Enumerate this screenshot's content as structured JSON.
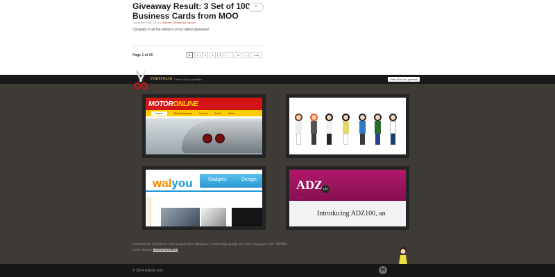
{
  "post": {
    "title": "Giveaway Result: 3 Set of 100 Business Cards from MOO",
    "comment_count": "+",
    "meta_date": "December 15th, 2011 in",
    "meta_categories": "Articles, Review by kailoon",
    "excerpt": "Congrats to all the winners of our latest giveaway!"
  },
  "pagination": {
    "label": "Page 1 of 15",
    "pages": [
      "1",
      "2",
      "3",
      "4",
      "5",
      "...",
      "15",
      "»",
      "Last"
    ]
  },
  "portfolio": {
    "title": "PORTFOLIO",
    "subtitle": "Check out my portfolio",
    "view_all": "View all of my portfolio",
    "tiles": [
      {
        "id": "motoronline",
        "logo_a": "MOTOR",
        "logo_b": "ONLINE",
        "nav": [
          "Home",
          "Berita/Updates",
          "Kereta",
          "Berita",
          "Moto"
        ]
      },
      {
        "id": "characters"
      },
      {
        "id": "walyou",
        "logo_a": "wal",
        "logo_b": "you",
        "nav": [
          "Gadgets",
          "Design"
        ]
      },
      {
        "id": "adz100",
        "logo": "ADZ",
        "badge": "100",
        "tagline": "... ... ...",
        "headline": "Introducing ADZ100, an"
      }
    ]
  },
  "about": {
    "line1": "I am kailoon. A freelance web designer from Malaysia. I create high quality web sites using pure CSS / XHTML.",
    "line2_prefix": "I also manage",
    "line2_link": "themeitation.com",
    "line2_suffix": "."
  },
  "footer": {
    "copyright": "© 2014 kailoon.com",
    "wp_glyph": "W"
  },
  "colors": {
    "background": "#3e3a36",
    "bar": "#191919",
    "accent_gold": "#e3c26f",
    "link_red": "#cc3333"
  },
  "icons": [
    "scissors-icon",
    "wordpress-icon",
    "mascot-girl-icon",
    "comment-bubble-icon"
  ]
}
